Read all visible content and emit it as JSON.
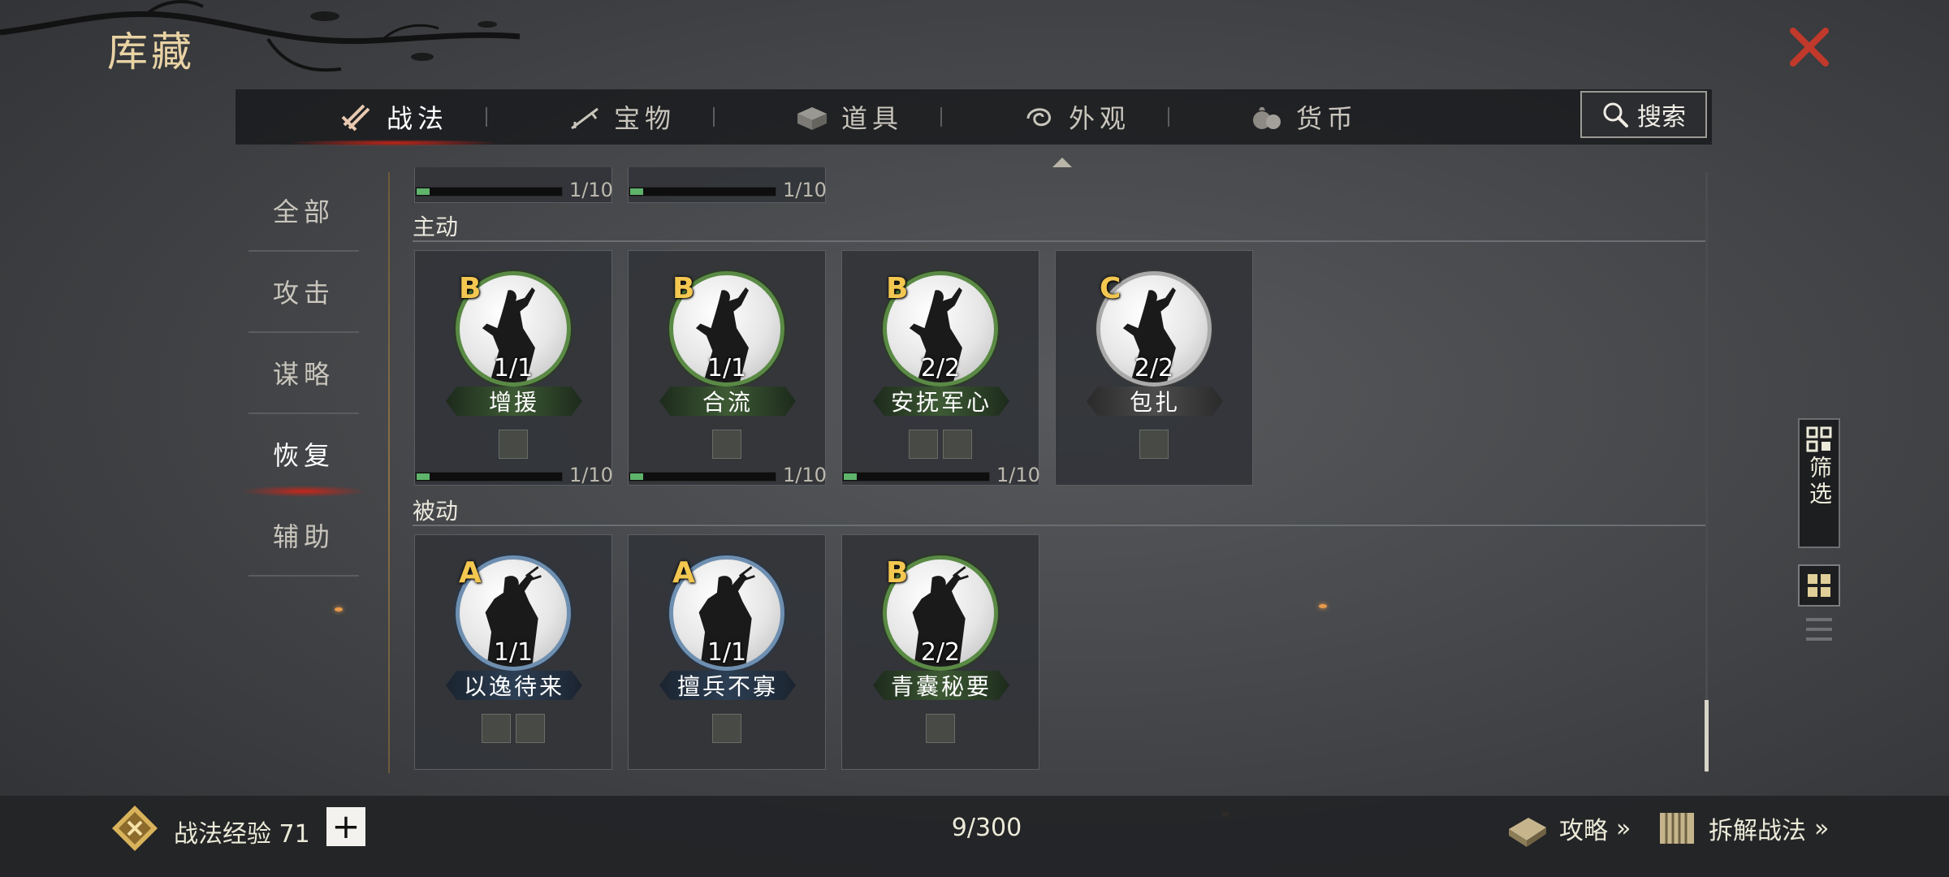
{
  "title": "库藏",
  "tabs": [
    {
      "label": "战法",
      "icon": "scroll-bundle-icon",
      "active": true
    },
    {
      "label": "宝物",
      "icon": "treasure-weapon-icon",
      "active": false
    },
    {
      "label": "道具",
      "icon": "item-box-icon",
      "active": false
    },
    {
      "label": "外观",
      "icon": "appearance-swirl-icon",
      "active": false
    },
    {
      "label": "货币",
      "icon": "money-bag-icon",
      "active": false
    }
  ],
  "search": {
    "label": "搜索"
  },
  "categories": [
    {
      "label": "全部",
      "active": false
    },
    {
      "label": "攻击",
      "active": false
    },
    {
      "label": "谋略",
      "active": false
    },
    {
      "label": "恢复",
      "active": true
    },
    {
      "label": "辅助",
      "active": false
    }
  ],
  "top_partial": [
    {
      "progress": "1/10",
      "fill": 0.1
    },
    {
      "progress": "1/10",
      "fill": 0.1
    }
  ],
  "sections": {
    "active": {
      "label": "主动",
      "cards": [
        {
          "grade": "B",
          "count": "1/1",
          "name": "增援",
          "tier": "green",
          "types": [
            "teapot-icon"
          ],
          "progress": "1/10",
          "fill": 0.1
        },
        {
          "grade": "B",
          "count": "1/1",
          "name": "合流",
          "tier": "green",
          "types": [
            "teapot-icon"
          ],
          "progress": "1/10",
          "fill": 0.1
        },
        {
          "grade": "B",
          "count": "2/2",
          "name": "安抚军心",
          "tier": "green",
          "types": [
            "soldier-icon",
            "teapot-icon"
          ],
          "progress": "1/10",
          "fill": 0.1
        },
        {
          "grade": "C",
          "count": "2/2",
          "name": "包扎",
          "tier": "gray",
          "types": [
            "teapot-icon"
          ],
          "progress": "",
          "fill": 0
        }
      ]
    },
    "passive": {
      "label": "被动",
      "cards": [
        {
          "grade": "A",
          "count": "1/1",
          "name": "以逸待来",
          "tier": "blue",
          "types": [
            "soldier-icon",
            "teapot-icon"
          ]
        },
        {
          "grade": "A",
          "count": "1/1",
          "name": "擅兵不寡",
          "tier": "blue",
          "types": [
            "teapot-icon"
          ]
        },
        {
          "grade": "B",
          "count": "2/2",
          "name": "青囊秘要",
          "tier": "green",
          "types": [
            "teapot-icon"
          ]
        }
      ]
    }
  },
  "filter": {
    "label": "筛选"
  },
  "bottom": {
    "exp_label": "战法经验 71",
    "plus": "+",
    "page_count": "9/300",
    "guide": "攻略",
    "dismantle": "拆解战法"
  },
  "colors": {
    "accent_red": "#c8261a",
    "grade_gold": "#f3c750",
    "title_gold": "#e9d3a4",
    "progress_green": "#5fb36b"
  }
}
